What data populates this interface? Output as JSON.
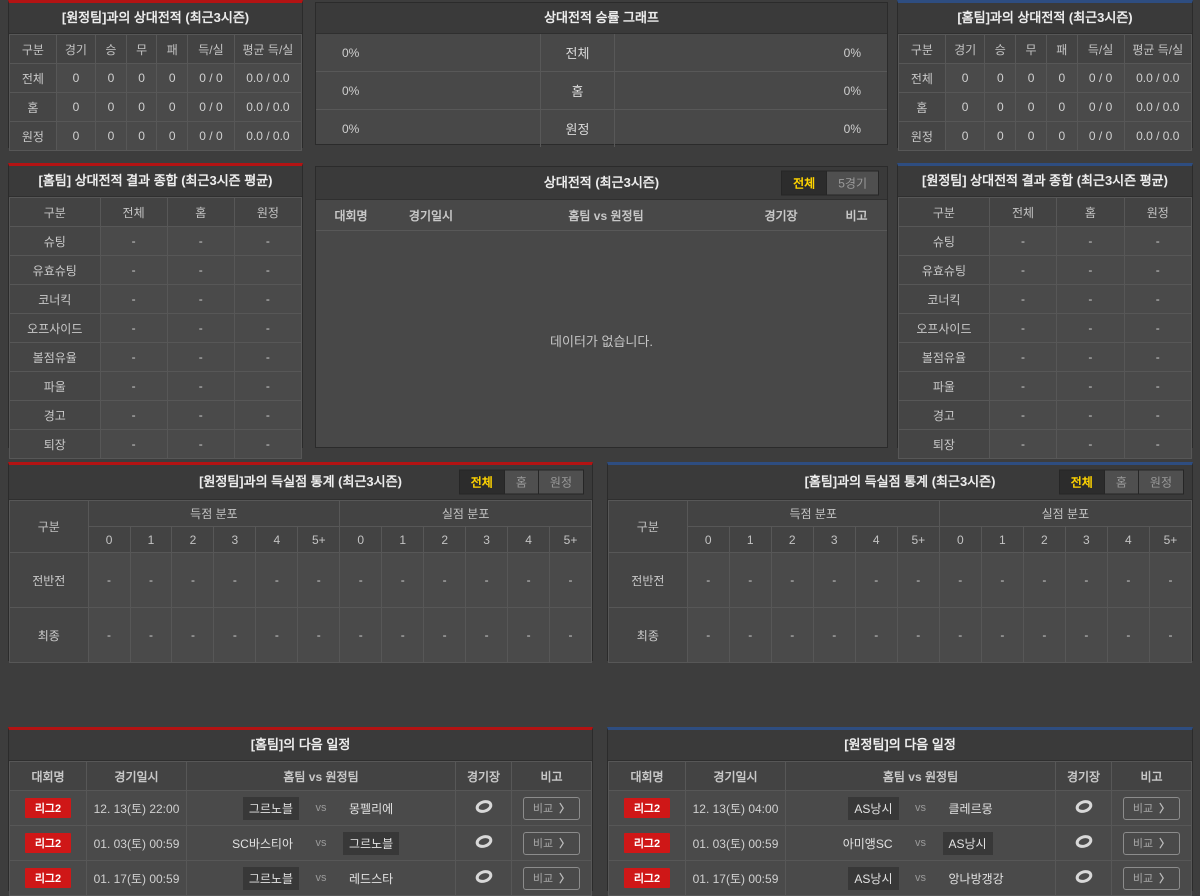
{
  "misc": {
    "vs": "vs",
    "chevron": "〉"
  },
  "colors": {
    "red_accent": "#b31313",
    "blue_accent": "#2e4d80",
    "badge_red": "#cf1717",
    "tab_active_text": "#ffd400"
  },
  "panels": {
    "h2h_away": {
      "title": "[원정팀]과의 상대전적 (최근3시즌)",
      "headers": [
        "구분",
        "경기",
        "승",
        "무",
        "패",
        "득/실",
        "평균 득/실"
      ],
      "rows": [
        {
          "label": "전체",
          "values": [
            "0",
            "0",
            "0",
            "0",
            "0 / 0",
            "0.0 / 0.0"
          ]
        },
        {
          "label": "홈",
          "values": [
            "0",
            "0",
            "0",
            "0",
            "0 / 0",
            "0.0 / 0.0"
          ]
        },
        {
          "label": "원정",
          "values": [
            "0",
            "0",
            "0",
            "0",
            "0 / 0",
            "0.0 / 0.0"
          ]
        }
      ]
    },
    "winrate": {
      "title": "상대전적 승률 그래프",
      "rows": [
        {
          "label": "전체",
          "left_value": "0%",
          "right_value": "0%"
        },
        {
          "label": "홈",
          "left_value": "0%",
          "right_value": "0%"
        },
        {
          "label": "원정",
          "left_value": "0%",
          "right_value": "0%"
        }
      ]
    },
    "h2h_home": {
      "title": "[홈팀]과의 상대전적 (최근3시즌)",
      "headers": [
        "구분",
        "경기",
        "승",
        "무",
        "패",
        "득/실",
        "평균 득/실"
      ],
      "rows": [
        {
          "label": "전체",
          "values": [
            "0",
            "0",
            "0",
            "0",
            "0 / 0",
            "0.0 / 0.0"
          ]
        },
        {
          "label": "홈",
          "values": [
            "0",
            "0",
            "0",
            "0",
            "0 / 0",
            "0.0 / 0.0"
          ]
        },
        {
          "label": "원정",
          "values": [
            "0",
            "0",
            "0",
            "0",
            "0 / 0",
            "0.0 / 0.0"
          ]
        }
      ]
    },
    "home_summary": {
      "title": "[홈팀] 상대전적 결과 종합 (최근3시즌 평균)",
      "headers": [
        "구분",
        "전체",
        "홈",
        "원정"
      ],
      "rows": [
        {
          "label": "슈팅",
          "values": [
            "-",
            "-",
            "-"
          ]
        },
        {
          "label": "유효슈팅",
          "values": [
            "-",
            "-",
            "-"
          ]
        },
        {
          "label": "코너킥",
          "values": [
            "-",
            "-",
            "-"
          ]
        },
        {
          "label": "오프사이드",
          "values": [
            "-",
            "-",
            "-"
          ]
        },
        {
          "label": "볼점유율",
          "values": [
            "-",
            "-",
            "-"
          ]
        },
        {
          "label": "파울",
          "values": [
            "-",
            "-",
            "-"
          ]
        },
        {
          "label": "경고",
          "values": [
            "-",
            "-",
            "-"
          ]
        },
        {
          "label": "퇴장",
          "values": [
            "-",
            "-",
            "-"
          ]
        }
      ]
    },
    "h2h_list": {
      "title": "상대전적 (최근3시즌)",
      "tabs": [
        {
          "label": "전체",
          "active": true
        },
        {
          "label": "5경기",
          "active": false
        }
      ],
      "headers": [
        "대회명",
        "경기일시",
        "홈팀 vs 원정팀",
        "경기장",
        "비고"
      ],
      "empty_message": "데이터가 없습니다."
    },
    "away_summary": {
      "title": "[원정팀] 상대전적 결과 종합 (최근3시즌 평균)",
      "headers": [
        "구분",
        "전체",
        "홈",
        "원정"
      ],
      "rows": [
        {
          "label": "슈팅",
          "values": [
            "-",
            "-",
            "-"
          ]
        },
        {
          "label": "유효슈팅",
          "values": [
            "-",
            "-",
            "-"
          ]
        },
        {
          "label": "코너킥",
          "values": [
            "-",
            "-",
            "-"
          ]
        },
        {
          "label": "오프사이드",
          "values": [
            "-",
            "-",
            "-"
          ]
        },
        {
          "label": "볼점유율",
          "values": [
            "-",
            "-",
            "-"
          ]
        },
        {
          "label": "파울",
          "values": [
            "-",
            "-",
            "-"
          ]
        },
        {
          "label": "경고",
          "values": [
            "-",
            "-",
            "-"
          ]
        },
        {
          "label": "퇴장",
          "values": [
            "-",
            "-",
            "-"
          ]
        }
      ]
    },
    "goals_away": {
      "title": "[원정팀]과의 득실점 통계 (최근3시즌)",
      "tabs": [
        {
          "label": "전체",
          "active": true
        },
        {
          "label": "홈",
          "active": false
        },
        {
          "label": "원정",
          "active": false
        }
      ],
      "col_label": "구분",
      "group_headers": [
        "득점 분포",
        "실점 분포"
      ],
      "score_columns": [
        "0",
        "1",
        "2",
        "3",
        "4",
        "5+"
      ],
      "rows": [
        {
          "label": "전반전",
          "values": [
            "-",
            "-",
            "-",
            "-",
            "-",
            "-",
            "-",
            "-",
            "-",
            "-",
            "-",
            "-"
          ]
        },
        {
          "label": "최종",
          "values": [
            "-",
            "-",
            "-",
            "-",
            "-",
            "-",
            "-",
            "-",
            "-",
            "-",
            "-",
            "-"
          ]
        }
      ]
    },
    "goals_home": {
      "title": "[홈팀]과의 득실점 통계 (최근3시즌)",
      "tabs": [
        {
          "label": "전체",
          "active": true
        },
        {
          "label": "홈",
          "active": false
        },
        {
          "label": "원정",
          "active": false
        }
      ],
      "col_label": "구분",
      "group_headers": [
        "득점 분포",
        "실점 분포"
      ],
      "score_columns": [
        "0",
        "1",
        "2",
        "3",
        "4",
        "5+"
      ],
      "rows": [
        {
          "label": "전반전",
          "values": [
            "-",
            "-",
            "-",
            "-",
            "-",
            "-",
            "-",
            "-",
            "-",
            "-",
            "-",
            "-"
          ]
        },
        {
          "label": "최종",
          "values": [
            "-",
            "-",
            "-",
            "-",
            "-",
            "-",
            "-",
            "-",
            "-",
            "-",
            "-",
            "-"
          ]
        }
      ]
    },
    "home_schedule": {
      "title": "[홈팀]의 다음 일정",
      "headers": [
        "대회명",
        "경기일시",
        "홈팀 vs 원정팀",
        "경기장",
        "비고"
      ],
      "rows": [
        {
          "league": "리그2",
          "datetime": "12. 13(토) 22:00",
          "home": "그르노블",
          "away": "몽펠리에",
          "compare": "비교"
        },
        {
          "league": "리그2",
          "datetime": "01. 03(토) 00:59",
          "home": "SC바스티아",
          "away": "그르노블",
          "compare": "비교"
        },
        {
          "league": "리그2",
          "datetime": "01. 17(토) 00:59",
          "home": "그르노블",
          "away": "레드스타",
          "compare": "비교"
        }
      ]
    },
    "away_schedule": {
      "title": "[원정팀]의 다음 일정",
      "headers": [
        "대회명",
        "경기일시",
        "홈팀 vs 원정팀",
        "경기장",
        "비고"
      ],
      "rows": [
        {
          "league": "리그2",
          "datetime": "12. 13(토) 04:00",
          "home": "AS낭시",
          "away": "클레르몽",
          "compare": "비교"
        },
        {
          "league": "리그2",
          "datetime": "01. 03(토) 00:59",
          "home": "아미앵SC",
          "away": "AS낭시",
          "compare": "비교"
        },
        {
          "league": "리그2",
          "datetime": "01. 17(토) 00:59",
          "home": "AS낭시",
          "away": "앙나방갱강",
          "compare": "비교"
        }
      ]
    }
  }
}
